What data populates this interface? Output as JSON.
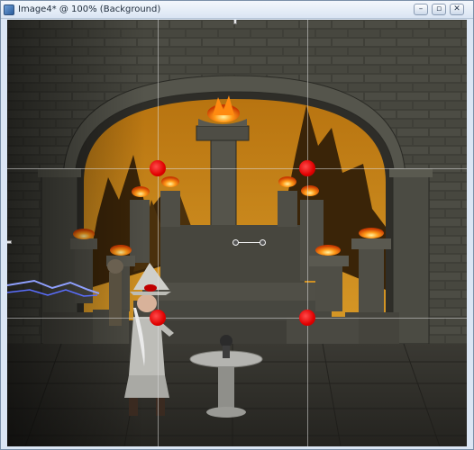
{
  "window": {
    "title": "Image4* @ 100% (Background)",
    "controls": {
      "minimize": "–",
      "maximize": "▫",
      "close": "✕"
    }
  },
  "canvas": {
    "image_description_icon": "fantasy-scene",
    "guides": {
      "horizontal_count": 2,
      "vertical_count": 2
    },
    "control_points_color": "#e00000"
  },
  "colors": {
    "titlebar": "#dae5f3",
    "stone": "#4a4a42",
    "sky": "#c98a1a",
    "fire": "#ff8a10"
  }
}
